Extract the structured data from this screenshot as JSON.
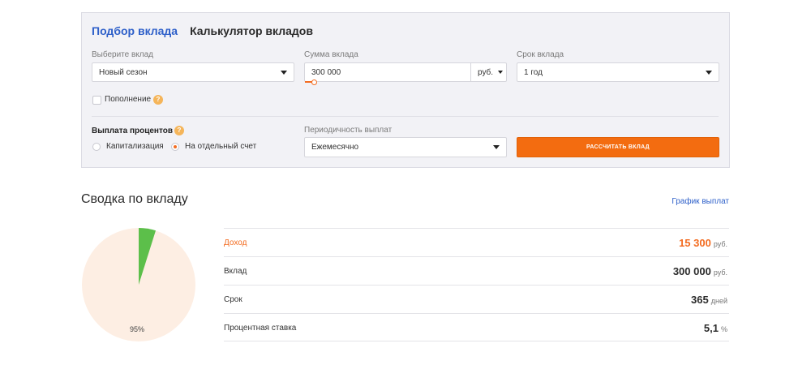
{
  "tabs": [
    "Подбор вклада",
    "Калькулятор вкладов"
  ],
  "form": {
    "deposit_label": "Выберите вклад",
    "deposit_value": "Новый сезон",
    "sum_label": "Сумма вклада",
    "sum_value": "300 000",
    "currency": "руб.",
    "term_label": "Срок вклада",
    "term_value": "1 год",
    "replenish_label": "Пополнение",
    "replenish_checked": false,
    "payout_title": "Выплата процентов",
    "payout_options": [
      "Капитализация",
      "На отдельный счет"
    ],
    "payout_selected": "На отдельный счет",
    "periodicity_label": "Периодичность выплат",
    "periodicity_value": "Ежемесячно",
    "calc_button": "РАССЧИТАТЬ ВКЛАД",
    "help_glyph": "?"
  },
  "summary": {
    "title": "Сводка по вкладу",
    "schedule_link": "График выплат",
    "pie_label": "95%",
    "rows": [
      {
        "label": "Доход",
        "value": "15 300",
        "unit": "руб."
      },
      {
        "label": "Вклад",
        "value": "300 000",
        "unit": "руб."
      },
      {
        "label": "Срок",
        "value": "365",
        "unit": "дней"
      },
      {
        "label": "Процентная ставка",
        "value": "5,1",
        "unit": "%"
      }
    ]
  },
  "chart_data": {
    "type": "pie",
    "slices": [
      {
        "label": "Вклад",
        "value": 300000,
        "color": "#fdeee3"
      },
      {
        "label": "Доход",
        "value": 15300,
        "color": "#5cbf4a"
      }
    ],
    "annotations": [
      "95%"
    ]
  },
  "colors": {
    "accent": "#f36c21",
    "link": "#2d5fc9",
    "pie_main": "#fdeee3",
    "pie_income": "#5cbf4a"
  }
}
